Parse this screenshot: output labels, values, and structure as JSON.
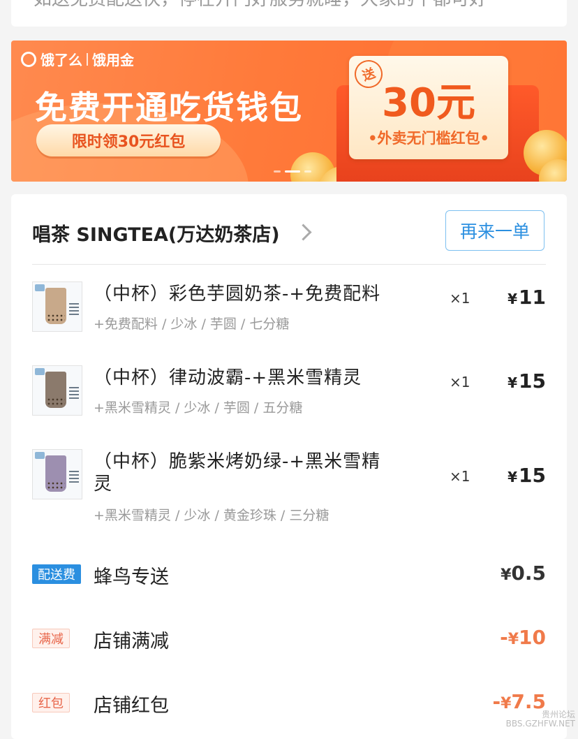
{
  "top_card": {
    "cut_text": "如送免费配送快，停在开门好服务就睡，大家的平都可好"
  },
  "banner": {
    "brand_name": "饿了么",
    "brand_sub": "饿用金",
    "headline": "免费开通吃货钱包",
    "cta": "限时领30元红包",
    "ticket_amount": "30元",
    "ticket_sub": "•外卖无门槛红包•",
    "stamp": "送",
    "colors": {
      "background": "#ff7a3a",
      "accent": "#f05a1e"
    }
  },
  "store": {
    "name": "唱茶 SINGTEA(万达奶茶店)",
    "reorder_label": "再来一单"
  },
  "items": [
    {
      "name": "（中杯）彩色芋圆奶茶-+免费配料",
      "options": "+免费配料 / 少冰 / 芋圆 / 七分糖",
      "qty": "×1",
      "currency": "¥",
      "price": "11",
      "cup_color": "#c8a98a"
    },
    {
      "name": "（中杯）律动波霸-+黑米雪精灵",
      "options": "+黑米雪精灵 / 少冰 / 芋圆 / 五分糖",
      "qty": "×1",
      "currency": "¥",
      "price": "15",
      "cup_color": "#8b7a6c"
    },
    {
      "name": "（中杯）脆紫米烤奶绿-+黑米雪精灵",
      "options": "+黑米雪精灵 / 少冰 / 黄金珍珠 / 三分糖",
      "qty": "×1",
      "currency": "¥",
      "price": "15",
      "cup_color": "#9d8fb0"
    }
  ],
  "fees": [
    {
      "badge": "配送费",
      "badge_style": "blue",
      "label": "蜂鸟专送",
      "sign": "",
      "currency": "¥",
      "amount": "0.5"
    },
    {
      "badge": "满减",
      "badge_style": "pink",
      "label": "店铺满减",
      "sign": "-",
      "currency": "¥",
      "amount": "10"
    },
    {
      "badge": "红包",
      "badge_style": "pink",
      "label": "店铺红包",
      "sign": "-",
      "currency": "¥",
      "amount": "7.5"
    }
  ],
  "watermark": {
    "line1": "贵州论坛",
    "line2": "BBS.GZHFW.NET"
  }
}
